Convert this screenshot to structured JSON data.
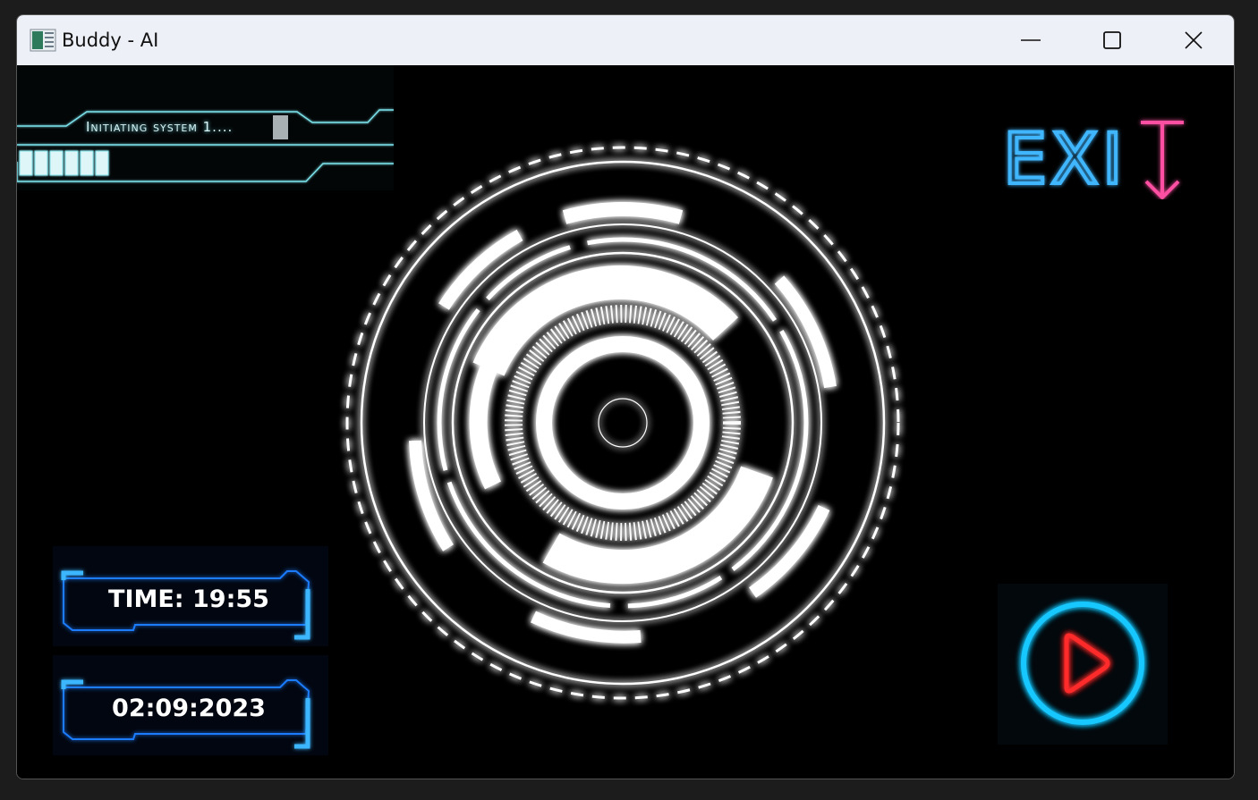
{
  "window": {
    "title": "Buddy - AI"
  },
  "loader": {
    "text": "Initiating system 1....",
    "segments_filled": 6
  },
  "exit_button": {
    "label": "EXIT",
    "colors": {
      "letters": "#3fb6ff",
      "arrow": "#ff4fa3"
    }
  },
  "time_panel": {
    "text": "TIME: 19:55"
  },
  "date_panel": {
    "text": "02:09:2023"
  },
  "play_button": {
    "icon": "play-icon",
    "colors": {
      "ring": "#19c8ff",
      "triangle": "#ff2a2a"
    }
  },
  "colors": {
    "hud_cyan": "#7be3ec",
    "panel_blue": "#1a7cff",
    "core_white": "#ffffff"
  }
}
